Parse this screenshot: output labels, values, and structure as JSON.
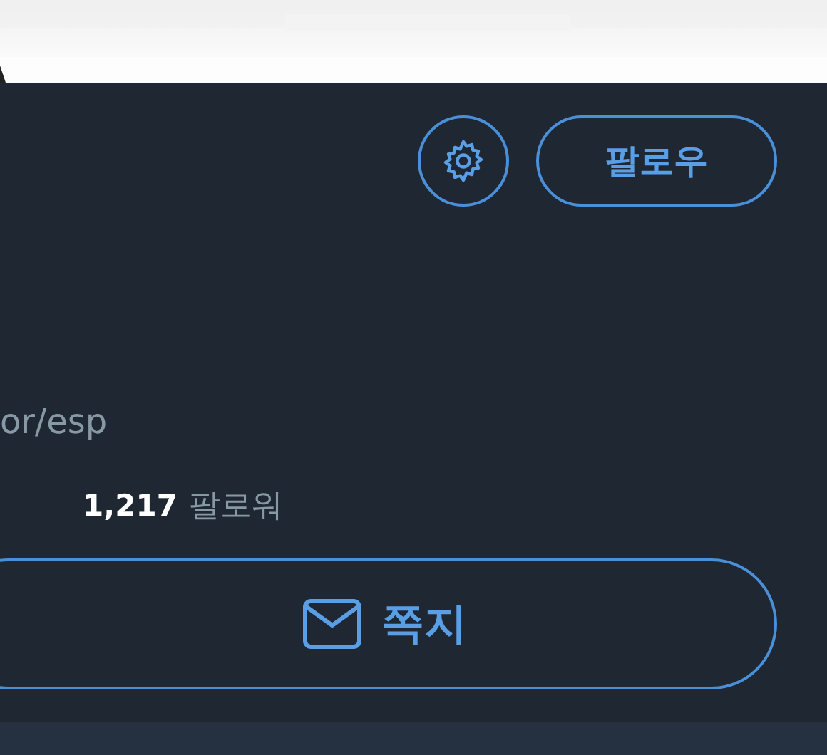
{
  "actions": {
    "follow_button": {
      "label": "팔로우"
    }
  },
  "profile": {
    "handle": "or/esp",
    "stats": [
      {
        "count": "1,217",
        "label": "팔로워"
      }
    ]
  },
  "message_button": {
    "label": "쪽지"
  }
}
